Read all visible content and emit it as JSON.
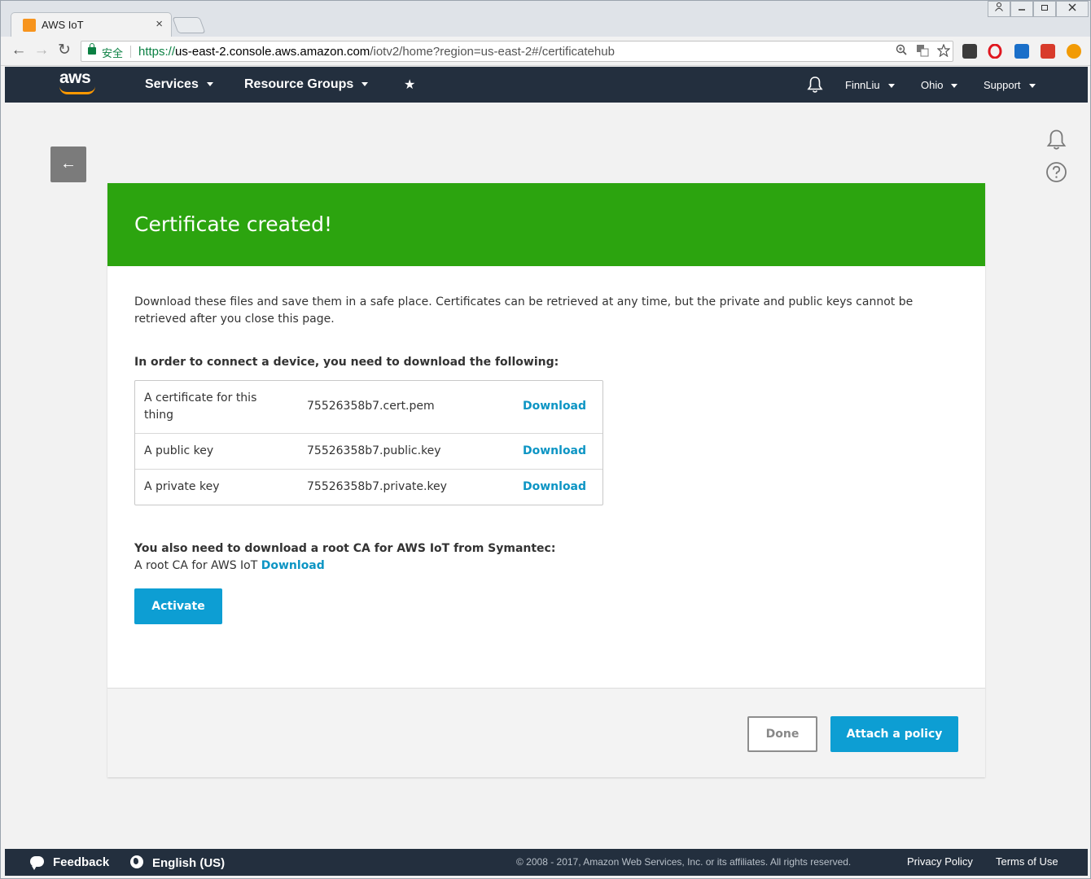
{
  "browser": {
    "tab_title": "AWS IoT",
    "tab_close": "×",
    "secure_label": "安全",
    "url_proto": "https://",
    "url_host": "us-east-2.console.aws.amazon.com",
    "url_path": "/iotv2/home?region=us-east-2#/certificatehub",
    "back": "←",
    "forward": "→",
    "reload": "↻"
  },
  "header": {
    "logo": "aws",
    "services": "Services",
    "resource_groups": "Resource Groups",
    "pin": "★",
    "user": "FinnLiu",
    "region": "Ohio",
    "support": "Support"
  },
  "page": {
    "back_arrow": "←",
    "banner_title": "Certificate created!",
    "intro": "Download these files and save them in a safe place. Certificates can be retrieved at any time, but the private and public keys cannot be retrieved after you close this page.",
    "files_heading": "In order to connect a device, you need to download the following:",
    "files": [
      {
        "label": "A certificate for this thing",
        "file": "75526358b7.cert.pem",
        "link": "Download"
      },
      {
        "label": "A public key",
        "file": "75526358b7.public.key",
        "link": "Download"
      },
      {
        "label": "A private key",
        "file": "75526358b7.private.key",
        "link": "Download"
      }
    ],
    "root_ca_heading": "You also need to download a root CA for AWS IoT from Symantec:",
    "root_ca_label": "A root CA for AWS IoT",
    "root_ca_link": "Download",
    "activate": "Activate",
    "done": "Done",
    "attach_policy": "Attach a policy"
  },
  "footer": {
    "feedback": "Feedback",
    "language": "English (US)",
    "copyright": "© 2008 - 2017, Amazon Web Services, Inc. or its affiliates. All rights reserved.",
    "privacy": "Privacy Policy",
    "terms": "Terms of Use"
  },
  "colors": {
    "banner": "#2ca40f",
    "primary_button": "#0d9ed3",
    "link": "#0d95c4",
    "header_bg": "#232f3e",
    "aws_orange": "#ff9900"
  }
}
